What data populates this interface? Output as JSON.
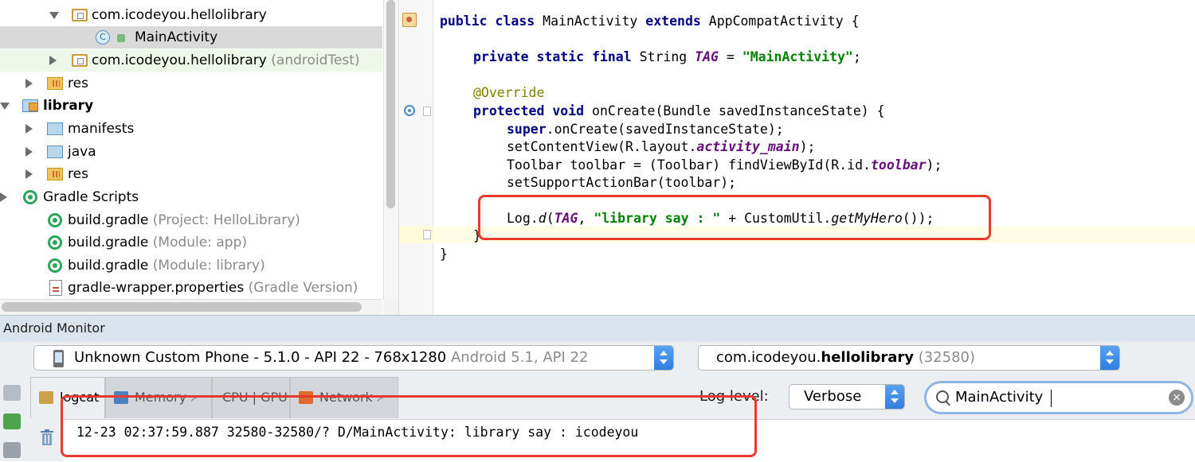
{
  "project_tree": {
    "items": [
      {
        "label": "com.icodeyou.hellolibrary",
        "hint": ""
      },
      {
        "label": "MainActivity",
        "hint": ""
      },
      {
        "label": "com.icodeyou.hellolibrary",
        "hint": " (androidTest)"
      },
      {
        "label": "res",
        "hint": ""
      },
      {
        "label": "library",
        "hint": ""
      },
      {
        "label": "manifests",
        "hint": ""
      },
      {
        "label": "java",
        "hint": ""
      },
      {
        "label": "res",
        "hint": ""
      },
      {
        "label": "Gradle Scripts",
        "hint": ""
      },
      {
        "label": "build.gradle",
        "hint": " (Project: HelloLibrary)"
      },
      {
        "label": "build.gradle",
        "hint": " (Module: app)"
      },
      {
        "label": "build.gradle",
        "hint": " (Module: library)"
      },
      {
        "label": "gradle-wrapper.properties",
        "hint": " (Gradle Version)"
      }
    ],
    "class_icon_letter": "C"
  },
  "editor": {
    "l1": {
      "a": "public class ",
      "b": "MainActivity ",
      "c": "extends ",
      "d": "AppCompatActivity {"
    },
    "l2": {
      "a": "private static final ",
      "b": "String ",
      "c": "TAG",
      "d": " = ",
      "e": "\"MainActivity\"",
      "f": ";"
    },
    "l3": "@Override",
    "l4": {
      "a": "protected void ",
      "b": "onCreate(Bundle savedInstanceState) {"
    },
    "l5": {
      "a": "super",
      "b": ".onCreate(savedInstanceState);"
    },
    "l6": {
      "a": "setContentView(R.layout.",
      "b": "activity_main",
      "c": ");"
    },
    "l7": {
      "a": "Toolbar toolbar = (Toolbar) findViewById(R.id.",
      "b": "toolbar",
      "c": ");"
    },
    "l8": "setSupportActionBar(toolbar);",
    "l9": {
      "a": "Log.",
      "b": "d",
      "c": "(",
      "d": "TAG",
      "e": ", ",
      "f": "\"library say : \"",
      "g": " + CustomUtil.",
      "h": "getMyHero",
      "i": "());"
    },
    "l10": "}",
    "l11": "}"
  },
  "monitor": {
    "title": "Android Monitor",
    "device": {
      "name": "Unknown Custom Phone - 5.1.0 - API 22 - 768x1280",
      "hint": " Android 5.1, API 22"
    },
    "process": {
      "prefix": "com.icodeyou.",
      "bold": "hellolibrary",
      "hint": " (32580)"
    },
    "tabs": [
      {
        "label": "logcat",
        "arrow": ""
      },
      {
        "label": "Memory",
        "arrow": "↗"
      },
      {
        "label": "CPU | GPU",
        "arrow": "↗"
      },
      {
        "label": "Network",
        "arrow": "↗"
      }
    ],
    "log_level_label": "Log level:",
    "log_level_value": "Verbose",
    "search_value": "MainActivity",
    "clear_glyph": "×",
    "log_line": "12-23 02:37:59.887 32580-32580/? D/MainActivity: library say : icodeyou"
  },
  "colors": {
    "highlight_box": "#e83a2e",
    "keyword": "#000080",
    "string": "#008000",
    "field": "#660e7a",
    "annotation": "#808000"
  }
}
